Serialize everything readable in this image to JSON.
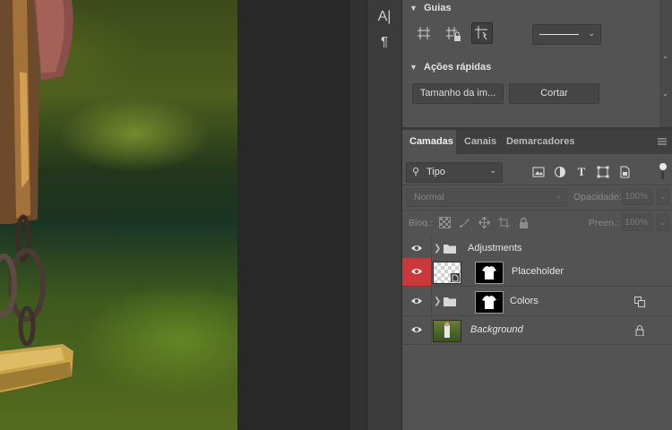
{
  "colors": {
    "panel_bg": "#535353",
    "tab_bar_bg": "#3f3f3f",
    "visibility_highlight": "#c9393b"
  },
  "char_strip": {
    "icons": [
      "character-icon",
      "paragraph-icon"
    ],
    "glyphs": [
      "A|",
      "¶"
    ]
  },
  "properties": {
    "guides": {
      "title": "Guias",
      "buttons": [
        "guide-grid-icon",
        "guide-lock-icon",
        "smart-guide-icon"
      ],
      "line_style": "solid-line"
    },
    "quick_actions": {
      "title": "Ações rápidas",
      "buttons": [
        {
          "label": "Tamanho da im..."
        },
        {
          "label": "Cortar"
        }
      ]
    }
  },
  "layers_panel": {
    "tabs": [
      {
        "label": "Camadas",
        "active": true
      },
      {
        "label": "Canais",
        "active": false
      },
      {
        "label": "Demarcadores",
        "active": false
      }
    ],
    "filter": {
      "label": "Tipo",
      "icons": [
        "pixel-filter-icon",
        "adjustment-filter-icon",
        "type-filter-icon",
        "shape-filter-icon",
        "smart-object-filter-icon"
      ]
    },
    "blend_mode": "Normal",
    "opacity_label": "Opacidade:",
    "opacity_value": "100%",
    "lock_label": "Bloq.:",
    "lock_icons": [
      "lock-pixels-icon",
      "lock-image-icon",
      "lock-position-icon",
      "lock-artboard-icon",
      "lock-all-icon"
    ],
    "fill_label": "Preen.:",
    "fill_value": "100%",
    "layers": [
      {
        "name": "Adjustments",
        "kind": "group",
        "visible": true,
        "highlight": false
      },
      {
        "name": "Placeholder",
        "kind": "smart-object-with-mask",
        "visible": true,
        "highlight": true
      },
      {
        "name": "Colors",
        "kind": "group-with-mask",
        "visible": true,
        "highlight": false,
        "badge": "clip-icon"
      },
      {
        "name": "Background",
        "kind": "background",
        "visible": true,
        "highlight": false,
        "badge": "lock-icon"
      }
    ]
  }
}
